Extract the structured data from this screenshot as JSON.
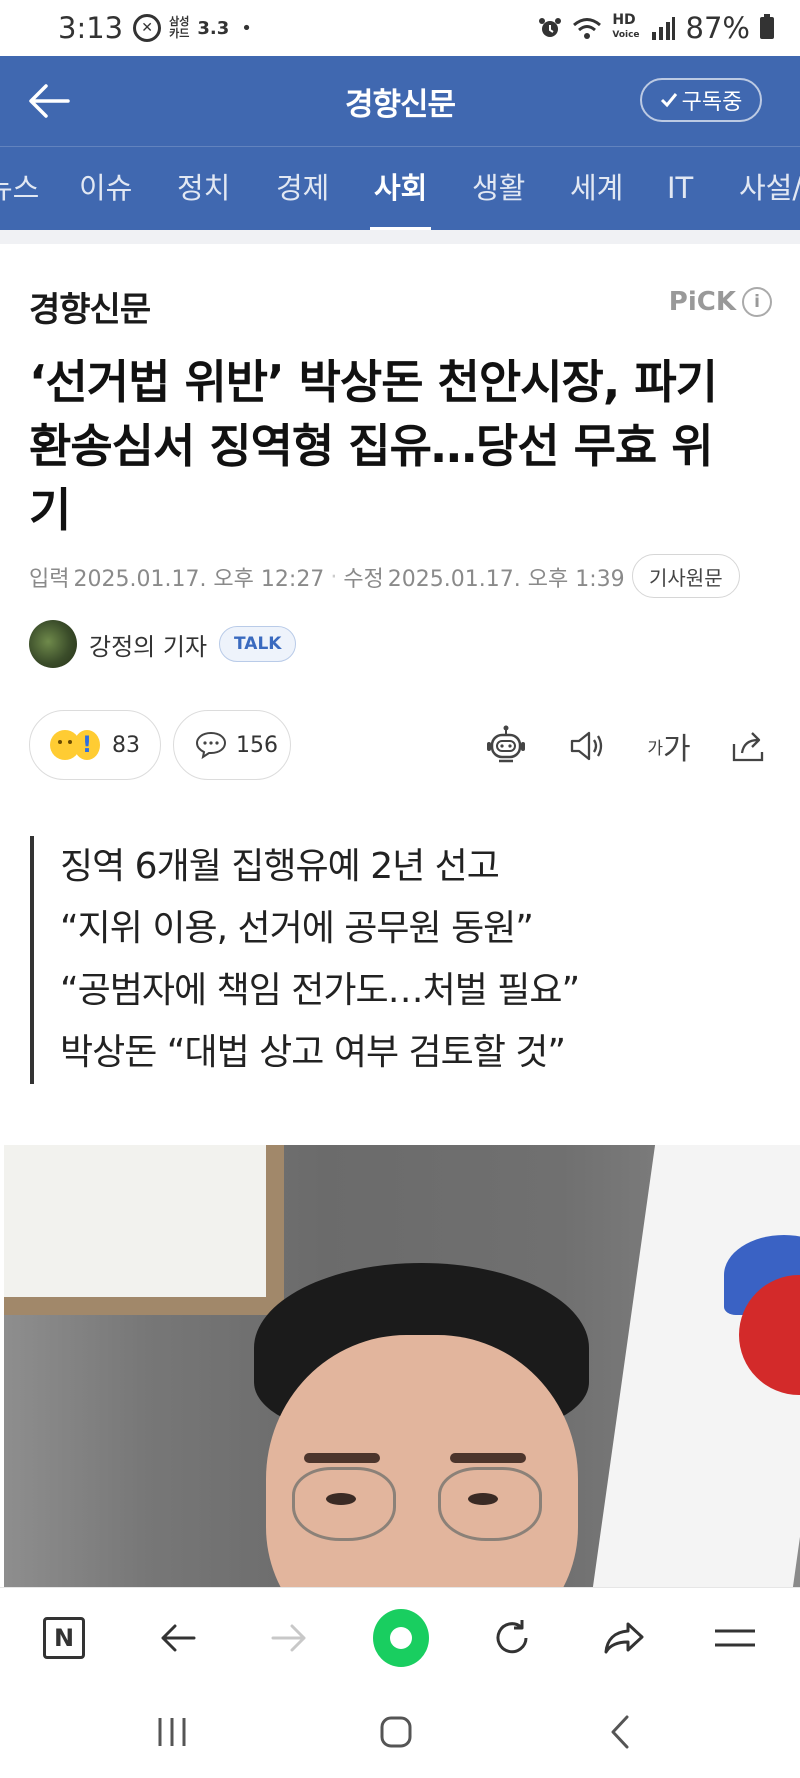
{
  "status_bar": {
    "time": "3:13",
    "carrier_line1": "삼성",
    "carrier_line2": "카드",
    "speed": "3.3",
    "dot": "•",
    "hd_line1": "HD",
    "hd_line2": "Voice",
    "battery": "87%"
  },
  "header": {
    "title": "경향신문",
    "subscribe_label": "구독중"
  },
  "tabs": [
    {
      "label": "뉴스"
    },
    {
      "label": "이슈"
    },
    {
      "label": "정치"
    },
    {
      "label": "경제"
    },
    {
      "label": "사회",
      "active": true
    },
    {
      "label": "생활"
    },
    {
      "label": "세계"
    },
    {
      "label": "IT"
    },
    {
      "label": "사설/"
    }
  ],
  "article": {
    "press": "경향신문",
    "pick_label": "PiCK",
    "headline_line1": "‘선거법 위반’ 박상돈 천안시장, 파기",
    "headline_line2": "환송심서 징역형 집유…당선 무효 위",
    "headline_line3": "기",
    "input_label": "입력",
    "input_date": "2025.01.17. 오후 12:27",
    "edit_label": "수정",
    "edit_date": "2025.01.17. 오후 1:39",
    "original_button": "기사원문",
    "author": "강정의 기자",
    "talk_label": "TALK",
    "reaction_count": "83",
    "comment_count": "156",
    "font_small": "가",
    "font_large": "가",
    "summary": [
      "징역 6개월 집행유예 2년 선고",
      "“지위 이용, 선거에 공무원 동원”",
      "“공범자에 책임 전가도…처벌 필요”",
      "박상돈 “대법 상고 여부 검토할 것”"
    ]
  },
  "toolbar": {
    "naver_label": "N"
  },
  "colors": {
    "brand_blue": "#4068b0",
    "naver_green": "#19ce60"
  }
}
